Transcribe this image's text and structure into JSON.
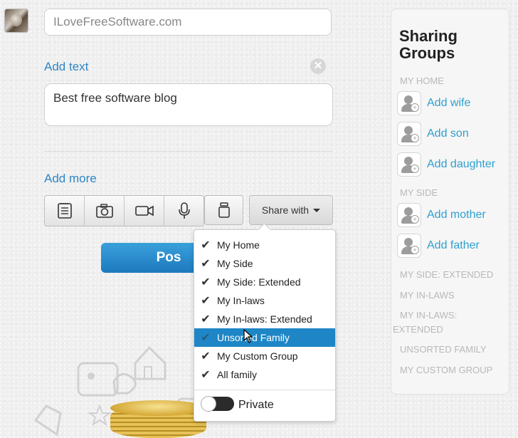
{
  "post_form": {
    "title_value": "ILoveFreeSoftware.com",
    "add_text_label": "Add text",
    "text_value": "Best free software blog",
    "add_more_label": "Add more",
    "share_with_label": "Share with",
    "post_button_label": "Pos"
  },
  "share_dropdown": {
    "items": [
      {
        "label": "My Home",
        "checked": true
      },
      {
        "label": "My Side",
        "checked": true
      },
      {
        "label": "My Side: Extended",
        "checked": true
      },
      {
        "label": "My In-laws",
        "checked": true
      },
      {
        "label": "My In-laws: Extended",
        "checked": true
      },
      {
        "label": "Unsorted Family",
        "checked": true,
        "highlighted": true
      },
      {
        "label": "My Custom Group",
        "checked": true
      },
      {
        "label": "All family",
        "checked": true
      }
    ],
    "private_label": "Private",
    "private_on": false
  },
  "sidebar": {
    "title_line1": "Sharing",
    "title_line2": "Groups",
    "my_home_heading": "MY HOME",
    "my_home_items": [
      "Add wife",
      "Add son",
      "Add daughter"
    ],
    "my_side_heading": "MY SIDE",
    "my_side_items": [
      "Add mother",
      "Add father"
    ],
    "other_groups": [
      "MY SIDE: EXTENDED",
      "MY IN-LAWS",
      "MY IN-LAWS:",
      "EXTENDED",
      "UNSORTED FAMILY",
      "MY CUSTOM GROUP"
    ]
  },
  "colors": {
    "accent": "#1e86c6",
    "link": "#2f86c4",
    "sidebar_link": "#2f9fd0"
  }
}
